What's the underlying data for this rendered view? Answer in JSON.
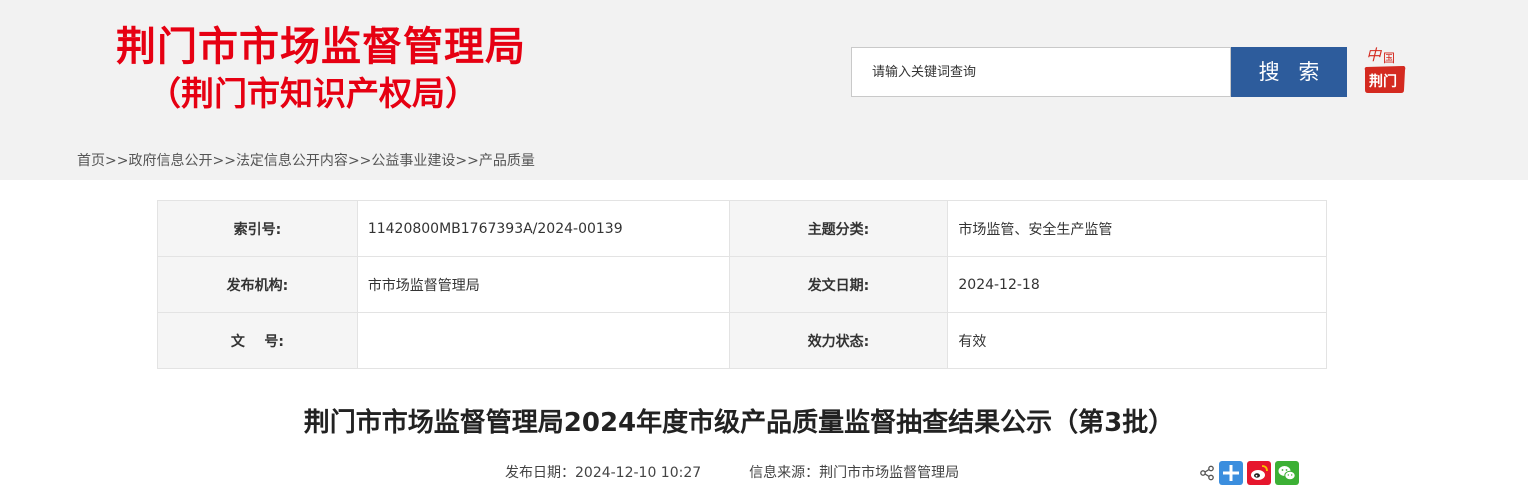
{
  "header": {
    "title_line1": "荆门市市场监督管理局",
    "title_line2": "（荆门市知识产权局）",
    "logo_text_top": "中国",
    "logo_text_bottom": "荆门",
    "colors": {
      "title_red": "#e60012",
      "search_blue": "#2d5c9c",
      "header_bg": "#f2f2f2"
    }
  },
  "search": {
    "placeholder": "请输入关键词查询",
    "button_label": "搜 索"
  },
  "breadcrumb": {
    "items": [
      "首页",
      "政府信息公开",
      "法定信息公开内容",
      "公益事业建设",
      "产品质量"
    ],
    "separator": ">>"
  },
  "meta": {
    "index_label": "索引号:",
    "index_value": "11420800MB1767393A/2024-00139",
    "topic_label": "主题分类:",
    "topic_value": "市场监管、安全生产监管",
    "publisher_label": "发布机构:",
    "publisher_value": "市市场监督管理局",
    "date_label": "发文日期:",
    "date_value": "2024-12-18",
    "docno_label": "文    号:",
    "docno_value": "",
    "status_label": "效力状态:",
    "status_value": "有效"
  },
  "article": {
    "title": "荆门市市场监督管理局2024年度市级产品质量监督抽查结果公示（第3批）",
    "publish_date": "发布日期：2024-12-10 10:27",
    "source": "信息来源：荆门市市场监督管理局"
  },
  "share": {
    "icons": [
      "share-icon",
      "qzone-plus-icon",
      "weibo-icon",
      "wechat-icon"
    ]
  }
}
